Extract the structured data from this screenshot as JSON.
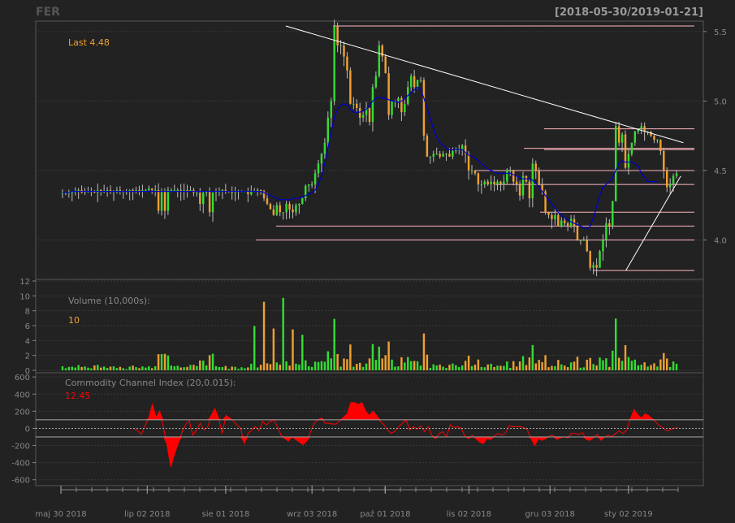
{
  "header": {
    "symbol": "FER",
    "date_range": "[2018-05-30/2019-01-21]"
  },
  "colors": {
    "background": "#222222",
    "grid": "#3a3a3a",
    "up": "#33dd33",
    "down": "#f0a030",
    "ma": "#0000cc",
    "cci": "#ff0000",
    "sr_lines": "#ffb6c1",
    "trend": "#ffffff",
    "label": "#888888"
  },
  "chart_data": [
    {
      "type": "candlestick",
      "panel": "price",
      "last_label": "Last 4.48",
      "y_ticks": [
        "4.0",
        "4.5",
        "5.0",
        "5.5"
      ],
      "ylim": [
        3.74,
        5.54
      ],
      "x_range": [
        "2018-05-30",
        "2019-01-21"
      ],
      "closes": [
        4.34,
        4.34,
        4.34,
        4.35,
        4.35,
        4.36,
        4.34,
        4.35,
        4.35,
        4.35,
        4.34,
        4.36,
        4.35,
        4.35,
        4.36,
        4.35,
        4.35,
        4.36,
        4.35,
        4.35,
        4.35,
        4.36,
        4.35,
        4.36,
        4.35,
        4.36,
        4.36,
        4.37,
        4.36,
        4.36,
        4.21,
        4.35,
        4.21,
        4.36,
        4.36,
        4.36,
        4.36,
        4.35,
        4.36,
        4.35,
        4.36,
        4.34,
        4.34,
        4.26,
        4.34,
        4.35,
        4.2,
        4.34,
        4.35,
        4.35,
        4.36,
        4.35,
        4.35,
        4.34,
        4.35,
        4.35,
        4.35,
        4.35,
        4.33,
        4.35,
        4.35,
        4.36,
        4.35,
        4.3,
        4.26,
        4.22,
        4.18,
        4.25,
        4.2,
        4.2,
        4.26,
        4.22,
        4.2,
        4.25,
        4.26,
        4.3,
        4.39,
        4.4,
        4.4,
        4.48,
        4.55,
        4.62,
        4.7,
        4.88,
        5.0,
        5.54,
        5.4,
        5.4,
        5.32,
        5.22,
        4.98,
        4.98,
        4.95,
        4.88,
        4.9,
        4.95,
        4.85,
        5.1,
        5.18,
        5.4,
        5.32,
        5.2,
        4.9,
        5.0,
        5.0,
        5.02,
        4.92,
        4.98,
        5.1,
        5.18,
        5.1,
        5.15,
        5.15,
        4.75,
        4.6,
        4.6,
        4.62,
        4.62,
        4.6,
        4.62,
        4.62,
        4.6,
        4.64,
        4.65,
        4.65,
        4.68,
        4.62,
        4.5,
        4.5,
        4.48,
        4.4,
        4.4,
        4.42,
        4.4,
        4.42,
        4.4,
        4.42,
        4.4,
        4.42,
        4.5,
        4.5,
        4.42,
        4.4,
        4.32,
        4.46,
        4.42,
        4.3,
        4.55,
        4.5,
        4.4,
        4.35,
        4.2,
        4.18,
        4.15,
        4.18,
        4.1,
        4.14,
        4.12,
        4.1,
        4.15,
        4.1,
        4.0,
        4.0,
        4.0,
        3.92,
        3.8,
        3.82,
        3.8,
        3.92,
        4.0,
        4.12,
        4.1,
        4.28,
        4.82,
        4.7,
        4.76,
        4.52,
        4.62,
        4.7,
        4.78,
        4.8,
        4.82,
        4.78,
        4.78,
        4.75,
        4.72,
        4.72,
        4.64,
        4.5,
        4.38,
        4.4,
        4.46,
        4.48
      ],
      "moving_average_closes": [
        4.34,
        4.34,
        4.34,
        4.35,
        4.35,
        4.35,
        4.35,
        4.35,
        4.35,
        4.35,
        4.35,
        4.35,
        4.35,
        4.35,
        4.35,
        4.35,
        4.35,
        4.35,
        4.35,
        4.35,
        4.35,
        4.35,
        4.35,
        4.35,
        4.35,
        4.35,
        4.35,
        4.35,
        4.35,
        4.35,
        4.35,
        4.35,
        4.35,
        4.35,
        4.35,
        4.35,
        4.35,
        4.35,
        4.35,
        4.35,
        4.35,
        4.35,
        4.35,
        4.35,
        4.35,
        4.35,
        4.35,
        4.35,
        4.35,
        4.35,
        4.35,
        4.35,
        4.35,
        4.35,
        4.35,
        4.35,
        4.35,
        4.35,
        4.35,
        4.35,
        4.35,
        4.35,
        4.35,
        4.34,
        4.33,
        4.32,
        4.31,
        4.3,
        4.29,
        4.29,
        4.29,
        4.29,
        4.3,
        4.3,
        4.3,
        4.31,
        4.32,
        4.33,
        4.34,
        4.36,
        4.4,
        4.46,
        4.55,
        4.66,
        4.78,
        4.88,
        4.94,
        4.97,
        4.98,
        4.97,
        4.94,
        4.92,
        4.92,
        4.92,
        4.93,
        4.94,
        4.97,
        5.0,
        5.02,
        5.03,
        5.02,
        5.02,
        5.01,
        5.0,
        5.0,
        4.99,
        5.0,
        5.02,
        5.04,
        5.06,
        5.08,
        5.1,
        5.08,
        5.02,
        4.95,
        4.87,
        4.8,
        4.74,
        4.7,
        4.68,
        4.66,
        4.65,
        4.65,
        4.65,
        4.65,
        4.65,
        4.63,
        4.61,
        4.6,
        4.59,
        4.57,
        4.55,
        4.53,
        4.51,
        4.5,
        4.49,
        4.48,
        4.48,
        4.48,
        4.48,
        4.48,
        4.47,
        4.46,
        4.45,
        4.44,
        4.44,
        4.44,
        4.43,
        4.41,
        4.38,
        4.35,
        4.32,
        4.29,
        4.26,
        4.23,
        4.2,
        4.18,
        4.16,
        4.15,
        4.13,
        4.12,
        4.11,
        4.1,
        4.09,
        4.08,
        4.1,
        4.16,
        4.24,
        4.32,
        4.38,
        4.4,
        4.42,
        4.45,
        4.5,
        4.55,
        4.57,
        4.56,
        4.56,
        4.56,
        4.55,
        4.53,
        4.48,
        4.45,
        4.42,
        4.42,
        4.42,
        4.42
      ],
      "support_resistance_levels": [
        5.54,
        4.8,
        4.66,
        4.65,
        4.5,
        4.4,
        4.2,
        4.1,
        4.0,
        3.78
      ],
      "trendlines": [
        {
          "from_date": "2018-08-24",
          "from_price": 5.54,
          "to_date": "2019-01-23",
          "to_price": 4.7
        },
        {
          "from_date": "2019-01-01",
          "from_price": 3.78,
          "to_date": "2019-01-22",
          "to_price": 4.46
        }
      ]
    },
    {
      "type": "bar",
      "panel": "volume",
      "label": "Volume (10,000s):",
      "last_label": "10",
      "y_ticks": [
        "0",
        "2",
        "4",
        "6",
        "8",
        "10",
        "12"
      ],
      "ylim": [
        0,
        12
      ]
    },
    {
      "type": "area",
      "panel": "cci",
      "label": "Commodity Channel Index (20,0.015):",
      "last_label": "12.45",
      "y_ticks": [
        "-600",
        "-400",
        "-200",
        "0",
        "200",
        "400",
        "600"
      ],
      "ylim": [
        -650,
        630
      ],
      "reference_lines": [
        100,
        0,
        -100
      ],
      "values": [
        0,
        -30,
        -70,
        30,
        120,
        280,
        130,
        200,
        10,
        -200,
        -450,
        -300,
        -180,
        -50,
        40,
        90,
        -80,
        -20,
        60,
        -20,
        10,
        150,
        230,
        120,
        -60,
        150,
        120,
        90,
        40,
        0,
        -180,
        -60,
        -20,
        20,
        -30,
        80,
        40,
        80,
        100,
        20,
        -80,
        -120,
        -150,
        -100,
        -130,
        -160,
        -190,
        -150,
        -40,
        60,
        100,
        120,
        60,
        60,
        50,
        50,
        90,
        130,
        170,
        300,
        300,
        280,
        300,
        200,
        150,
        200,
        150,
        80,
        40,
        -20,
        -60,
        -30,
        20,
        60,
        100,
        -20,
        20,
        -10,
        30,
        -40,
        20,
        -80,
        -120,
        -60,
        -40,
        -100,
        40,
        10,
        20,
        0,
        -90,
        -120,
        -80,
        -120,
        -160,
        -180,
        -120,
        -130,
        -90,
        -60,
        -80,
        -60,
        30,
        20,
        20,
        20,
        10,
        -20,
        -120,
        -200,
        -120,
        -140,
        -120,
        -90,
        -80,
        -130,
        -110,
        -100,
        -110,
        -60,
        -60,
        -70,
        -50,
        -130,
        -140,
        -110,
        -70,
        -140,
        -100,
        -80,
        -100,
        -60,
        -30,
        -60,
        -20,
        110,
        220,
        160,
        120,
        170,
        150,
        110,
        70,
        30,
        0,
        -30,
        -10,
        0,
        10
      ]
    }
  ],
  "x_axis": {
    "tick_labels": [
      "maj 30 2018",
      "lip 02 2018",
      "sie 01 2018",
      "wrz 03 2018",
      "paź 01 2018",
      "lis 02 2018",
      "gru 03 2018",
      "sty 02 2019"
    ],
    "tick_dates": [
      "2018-05-30",
      "2018-07-02",
      "2018-08-01",
      "2018-09-03",
      "2018-10-01",
      "2018-11-02",
      "2018-12-03",
      "2019-01-02"
    ]
  }
}
